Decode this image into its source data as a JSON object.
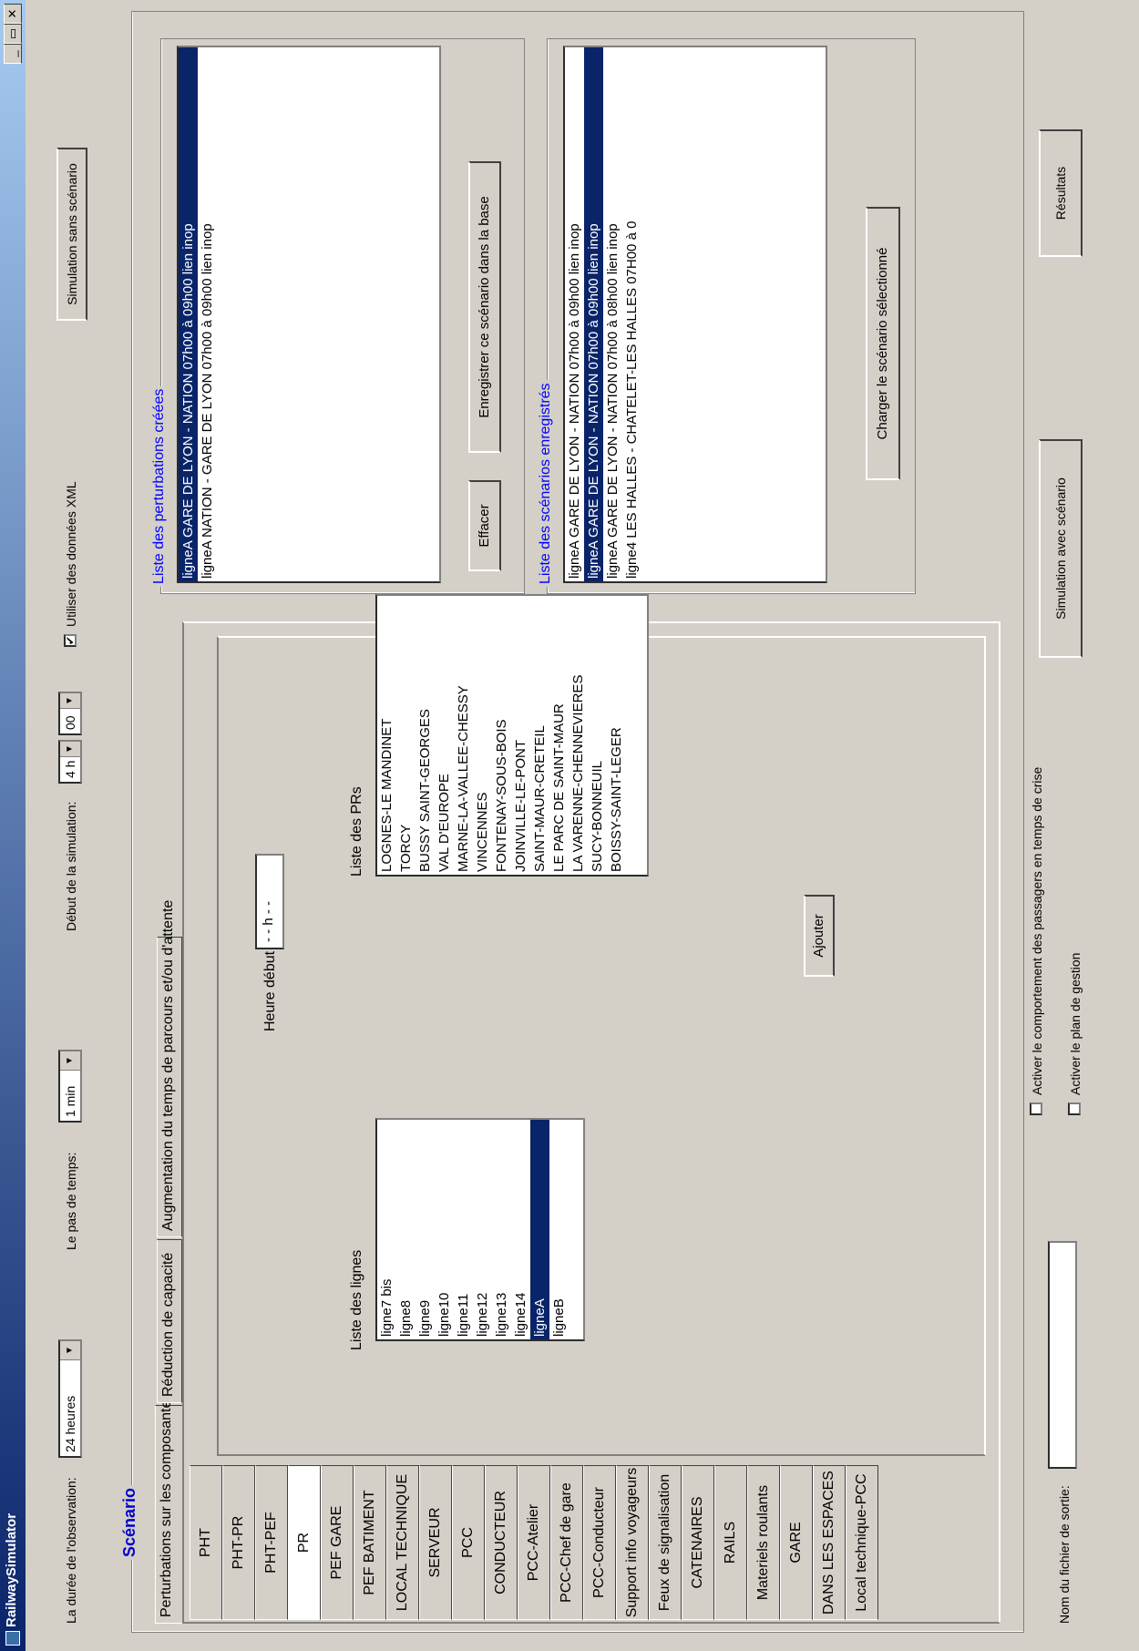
{
  "window": {
    "title": "RailwaySimulator",
    "minimize": "_",
    "maximize": "▭",
    "close": "✕"
  },
  "topbar": {
    "duree_label": "La durée de l'observation:",
    "duree_value": "24 heures",
    "pas_label": "Le pas de temps:",
    "pas_value": "1 min",
    "debut_label": "Début de la simulation:",
    "debut_hour": "4 h",
    "debut_min": "00",
    "xml_checked": "✔",
    "xml_label": "Utiliser des données XML",
    "sim_sans_label": "Simulation sans scénario"
  },
  "scenario": {
    "title": "Scénario",
    "tabs": [
      "Perturbations sur les composantes",
      "Réduction de capacité",
      "Augmentation du temps de parcours et/ou d'attente"
    ],
    "components": [
      "PHT",
      "PHT-PR",
      "PHT-PEF",
      "PR",
      "PEF GARE",
      "PEF BATIMENT",
      "LOCAL TECHNIQUE",
      "SERVEUR",
      "PCC",
      "CONDUCTEUR",
      "PCC-Atelier",
      "PCC-Chef de gare",
      "PCC-Conducteur",
      "Support info voyageurs",
      "Feux de signalisation",
      "CATENAIRES",
      "RAILS",
      "Materiels roulants",
      "GARE",
      "DANS LES ESPACES",
      "Local technique-PCC"
    ],
    "lignes_label": "Liste des lignes",
    "lignes": [
      "ligne7 bis",
      "ligne8",
      "ligne9",
      "ligne10",
      "ligne11",
      "ligne12",
      "ligne13",
      "ligne14",
      "ligneA",
      "ligneB"
    ],
    "heure_label": "Heure début",
    "heure_value": "- - h - -",
    "prs_label": "Liste des PRs",
    "prs": [
      "LOGNES-LE MANDINET",
      "TORCY",
      "BUSSY SAINT-GEORGES",
      "VAL D'EUROPE",
      "MARNE-LA-VALLEE-CHESSY",
      "VINCENNES",
      "FONTENAY-SOUS-BOIS",
      "JOINVILLE-LE-PONT",
      "SAINT-MAUR-CRETEIL",
      "LE PARC DE SAINT-MAUR",
      "LA VARENNE-CHENNEVIERES",
      "SUCY-BONNEUIL",
      "BOISSY-SAINT-LEGER"
    ],
    "ajouter_label": "Ajouter"
  },
  "perturbations": {
    "title": "Liste des perturbations créées",
    "items": [
      "ligneA GARE DE LYON - NATION 07h00 à 09h00 lien inop",
      "ligneA NATION - GARE DE LYON 07h00 à 09h00 lien inop"
    ],
    "effacer_label": "Effacer",
    "enregistrer_label": "Enregistrer ce scénario dans la base"
  },
  "scenarios": {
    "title": "Liste des scénarios enregistrés",
    "items": [
      "ligneA GARE DE LYON - NATION 07h00 à 09h00 lien inop",
      "ligneA GARE DE LYON - NATION 07h00 à 09h00 lien inop",
      "ligneA GARE DE LYON - NATION 07h00 à 08h00 lien inop",
      "ligne4 LES HALLES - CHATELET-LES HALLES 07H00 à 0"
    ],
    "charger_label": "Charger le scénario sélectionné"
  },
  "footer": {
    "fichier_label": "Nom du fichier de sortie:",
    "fichier_value": "",
    "crise_label": "Activer le comportement des passagers en temps de crise",
    "gestion_label": "Activer le plan de gestion",
    "sim_avec_label": "Simulation avec scénario",
    "resultats_label": "Résultats"
  }
}
